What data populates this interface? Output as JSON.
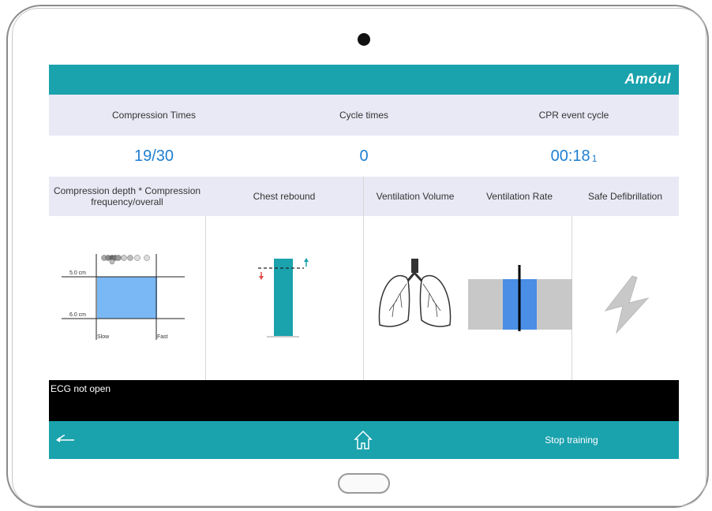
{
  "logo": "Amóul",
  "stats": {
    "compression_times_label": "Compression Times",
    "cycle_times_label": "Cycle times",
    "cpr_event_cycle_label": "CPR event cycle",
    "compression_times_value": "19/30",
    "cycle_times_value": "0",
    "cpr_event_cycle_value": "00:18",
    "cpr_event_cycle_sub": "1"
  },
  "metrics": {
    "depth_frequency_label": "Compression depth * Compression frequency/overall",
    "chest_rebound_label": "Chest rebound",
    "ventilation_volume_label": "Ventilation Volume",
    "ventilation_rate_label": "Ventilation Rate",
    "safe_defibrillation_label": "Safe Defibrillation"
  },
  "depth_chart": {
    "upper_label": "5.0 cm",
    "lower_label": "6.0 cm",
    "slow_label": "Slow",
    "fast_label": "Fast"
  },
  "ecg": {
    "status": "ECG not open"
  },
  "footer": {
    "stop_label": "Stop training"
  },
  "colors": {
    "accent": "#1aa2ad",
    "value_blue": "#1f7fd1",
    "zone_blue": "#7ab8f5",
    "header_bg": "#e9e9f6"
  }
}
